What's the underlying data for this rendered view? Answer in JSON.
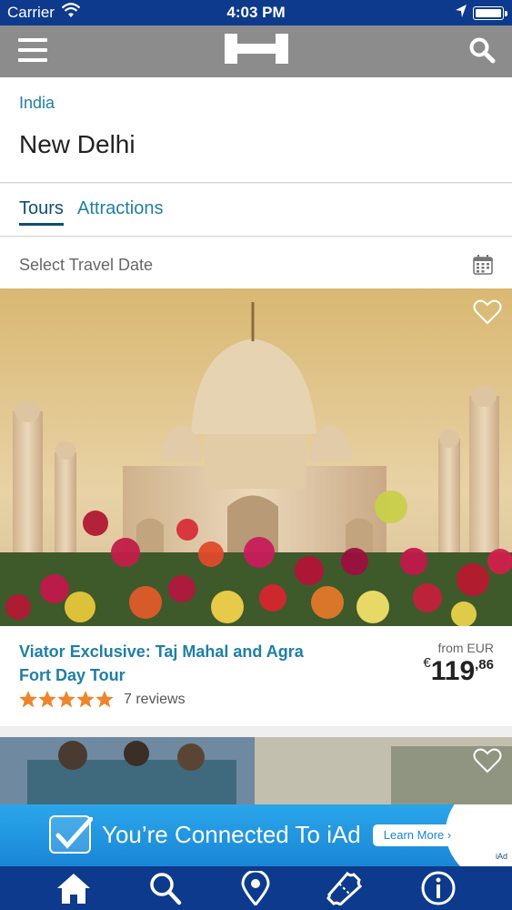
{
  "status_bar": {
    "carrier": "Carrier",
    "time": "4:03 PM"
  },
  "nav": {
    "menu_icon": "hamburger-menu-icon",
    "logo_icon": "hotels-h-logo",
    "search_icon": "search-icon"
  },
  "location": {
    "country": "India",
    "city": "New Delhi"
  },
  "tabs": [
    {
      "label": "Tours",
      "active": true
    },
    {
      "label": "Attractions",
      "active": false
    }
  ],
  "date_selector": {
    "label": "Select Travel Date",
    "icon": "calendar-icon"
  },
  "tours": [
    {
      "title": "Viator Exclusive: Taj Mahal and Agra Fort Day Tour",
      "rating": 5,
      "reviews": "7 reviews",
      "from_label": "from EUR",
      "price_currency": "€",
      "price_int": "119",
      "price_cents": ",86"
    }
  ],
  "ad": {
    "text": "You’re Connected To iAd",
    "button": "Learn More ›",
    "tag": "iAd"
  },
  "bottom_tabs": [
    "home-icon",
    "search-icon",
    "location-pin-icon",
    "ticket-icon",
    "info-icon"
  ],
  "colors": {
    "status_bar": "#0d3a8c",
    "nav_bar": "#8c8c8c",
    "link": "#1f7fa6",
    "star": "#f0842c"
  }
}
